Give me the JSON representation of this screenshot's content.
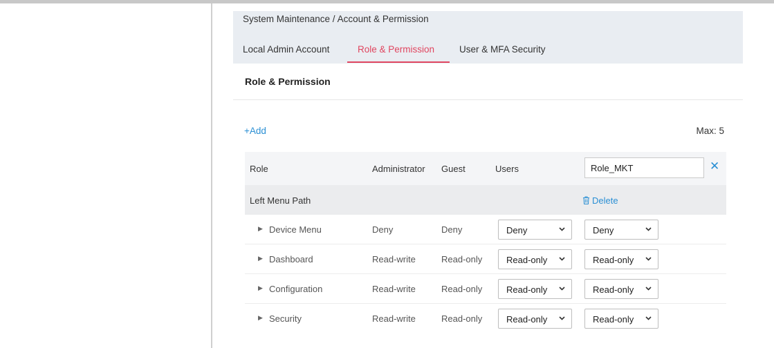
{
  "breadcrumb": "System Maintenance / Account & Permission",
  "tabs": [
    {
      "label": "Local Admin Account",
      "active": false
    },
    {
      "label": "Role & Permission",
      "active": true
    },
    {
      "label": "User & MFA Security",
      "active": false
    }
  ],
  "card": {
    "title": "Role & Permission",
    "add_label": "+Add",
    "max_label": "Max: 5"
  },
  "table": {
    "headers": {
      "role": "Role",
      "administrator": "Administrator",
      "guest": "Guest",
      "users": "Users"
    },
    "new_role_value": "Role_MKT",
    "clear_icon": "close-icon",
    "group_label": "Left Menu Path",
    "delete_label": "Delete",
    "rows": [
      {
        "name": "Device Menu",
        "administrator": "Deny",
        "guest": "Deny",
        "users": "Deny",
        "new_role": "Deny"
      },
      {
        "name": "Dashboard",
        "administrator": "Read-write",
        "guest": "Read-only",
        "users": "Read-only",
        "new_role": "Read-only"
      },
      {
        "name": "Configuration",
        "administrator": "Read-write",
        "guest": "Read-only",
        "users": "Read-only",
        "new_role": "Read-only"
      },
      {
        "name": "Security",
        "administrator": "Read-write",
        "guest": "Read-only",
        "users": "Read-only",
        "new_role": "Read-only"
      }
    ]
  },
  "colors": {
    "accent_tab": "#e0455f",
    "link": "#2a8fd4",
    "header_bg": "#e9edf2"
  }
}
